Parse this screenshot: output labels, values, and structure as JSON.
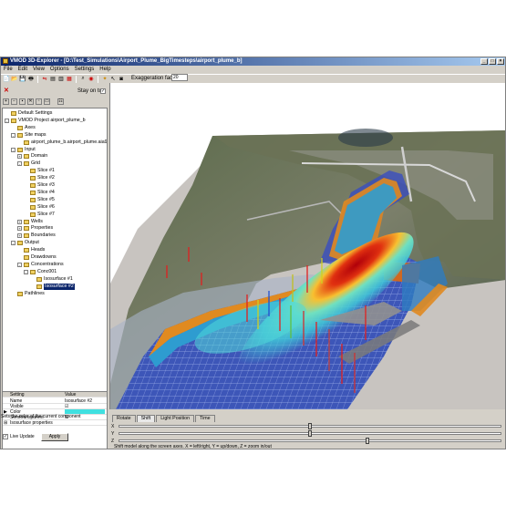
{
  "window": {
    "title": "VMOD 3D-Explorer - [D:\\Test_Simulations\\Airport_Plume_BigTimesteps\\airport_plume_b]",
    "buttons": [
      "_",
      "□",
      "×"
    ]
  },
  "menu": [
    "File",
    "Edit",
    "View",
    "Options",
    "Settings",
    "Help"
  ],
  "toolbar": {
    "exaggeration_label": "Exaggeration factor",
    "exaggeration_value": "20"
  },
  "left_panel": {
    "stay_on_top": "Stay on top",
    "tree": [
      {
        "label": "Default Settings",
        "indent": 0,
        "exp": ""
      },
      {
        "label": "VMOD Project airport_plume_b",
        "indent": 0,
        "exp": "-"
      },
      {
        "label": "Axes",
        "indent": 1,
        "exp": ""
      },
      {
        "label": "Site maps",
        "indent": 1,
        "exp": "-"
      },
      {
        "label": "airport_plume_b.airport_plume.aia90H_b",
        "indent": 2,
        "exp": ""
      },
      {
        "label": "Input",
        "indent": 1,
        "exp": "-"
      },
      {
        "label": "Domain",
        "indent": 2,
        "exp": "+"
      },
      {
        "label": "Grid",
        "indent": 2,
        "exp": "-"
      },
      {
        "label": "Slice #1",
        "indent": 3,
        "exp": ""
      },
      {
        "label": "Slice #2",
        "indent": 3,
        "exp": ""
      },
      {
        "label": "Slice #3",
        "indent": 3,
        "exp": ""
      },
      {
        "label": "Slice #4",
        "indent": 3,
        "exp": ""
      },
      {
        "label": "Slice #5",
        "indent": 3,
        "exp": ""
      },
      {
        "label": "Slice #6",
        "indent": 3,
        "exp": ""
      },
      {
        "label": "Slice #7",
        "indent": 3,
        "exp": ""
      },
      {
        "label": "Wells",
        "indent": 2,
        "exp": "+"
      },
      {
        "label": "Properties",
        "indent": 2,
        "exp": "+"
      },
      {
        "label": "Boundaries",
        "indent": 2,
        "exp": "+"
      },
      {
        "label": "Output",
        "indent": 1,
        "exp": "-"
      },
      {
        "label": "Heads",
        "indent": 2,
        "exp": ""
      },
      {
        "label": "Drawdowns",
        "indent": 2,
        "exp": ""
      },
      {
        "label": "Concentrations",
        "indent": 2,
        "exp": "-"
      },
      {
        "label": "Conc001",
        "indent": 3,
        "exp": "-"
      },
      {
        "label": "Isosurface #1",
        "indent": 4,
        "exp": ""
      },
      {
        "label": "Isosurface #2",
        "indent": 4,
        "exp": "",
        "selected": true
      },
      {
        "label": "Pathlines",
        "indent": 1,
        "exp": ""
      }
    ],
    "props_header": {
      "setting": "Setting",
      "value": "Value"
    },
    "props": [
      {
        "k": "Name",
        "v": "Isosurface #2"
      },
      {
        "k": "Visible",
        "v": "☑"
      },
      {
        "k": "Color",
        "v": ""
      },
      {
        "k": "Semitransparent",
        "v": "☑"
      },
      {
        "k": "Isosurface properties",
        "v": ""
      }
    ],
    "description": "Sets the color of the current component",
    "live_update": "Live Update",
    "apply": "Apply"
  },
  "tabs": [
    "Rotate",
    "Shift",
    "Light Position",
    "Time"
  ],
  "sliders": [
    {
      "axis": "X",
      "pos": 0.5
    },
    {
      "axis": "Y",
      "pos": 0.5
    },
    {
      "axis": "Z",
      "pos": 0.65
    }
  ],
  "hint": "Shift model along the screen axes. X = left/right, Y = up/down, Z = zoom in/out"
}
